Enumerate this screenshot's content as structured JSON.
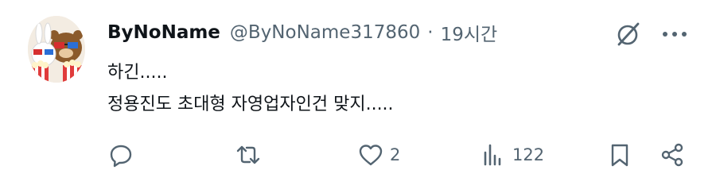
{
  "tweet": {
    "author_name": "ByNoName",
    "author_handle": "@ByNoName317860",
    "separator": "·",
    "time": "19시간",
    "text_lines": [
      "하긴.....",
      "정용진도 초대형 자영업자인건 맞지....."
    ]
  },
  "actions": {
    "reply_count": "",
    "retweet_count": "",
    "like_count": "2",
    "view_count": "122"
  },
  "icons": {
    "avatar": "cartoon-bears-3d-glasses-popcorn-avatar",
    "grok": "grok-slash-circle-icon",
    "more": "more-horizontal-icon",
    "reply": "reply-bubble-icon",
    "retweet": "retweet-icon",
    "like": "heart-icon",
    "views": "views-bar-chart-icon",
    "bookmark": "bookmark-icon",
    "share": "share-icon"
  },
  "colors": {
    "text": "#0f1419",
    "secondary": "#536471",
    "background": "#ffffff"
  }
}
